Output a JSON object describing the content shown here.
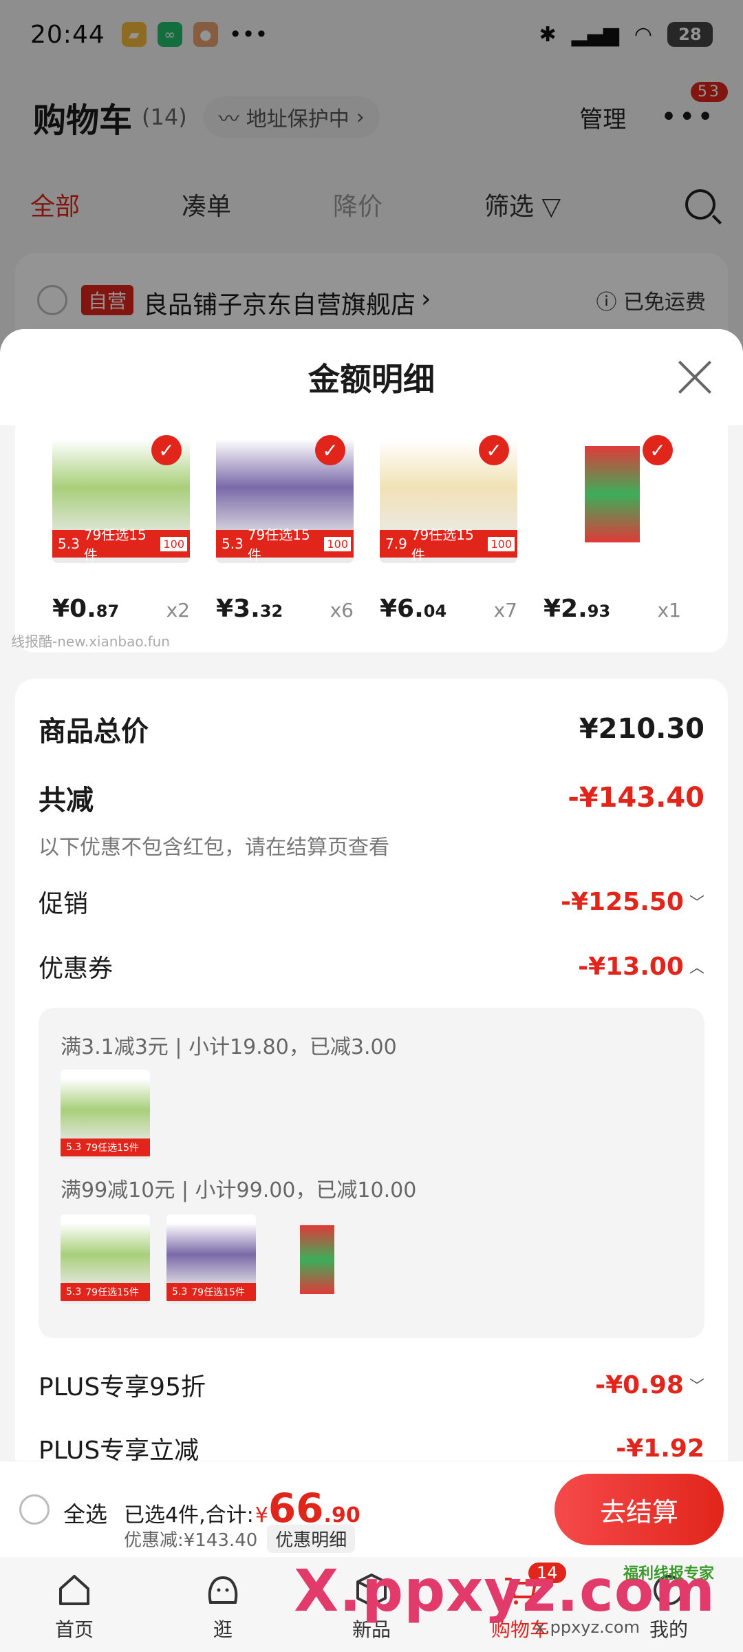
{
  "status_bar": {
    "time": "20:44",
    "dots": "•••",
    "battery": "28"
  },
  "cart": {
    "title": "购物车",
    "count": "(14)",
    "address_pill": "地址保护中",
    "manage": "管理",
    "more_badge": "53",
    "tabs": [
      "全部",
      "凑单",
      "降价",
      "筛选"
    ],
    "shop": {
      "self_tag": "自营",
      "name": "良品铺子京东自营旗舰店",
      "shipping": "已免运费"
    }
  },
  "sheet": {
    "title": "金额明细",
    "watermark": "线报酷-new.xianbao.fun",
    "products": [
      {
        "price_int": "¥0.",
        "price_dec": "87",
        "qty": "x2",
        "color": "#a8cf7a",
        "promo": "79任选15件",
        "promo_price": "5.3"
      },
      {
        "price_int": "¥3.",
        "price_dec": "32",
        "qty": "x6",
        "color": "#7a6aa8",
        "promo": "79任选15件",
        "promo_price": "5.3"
      },
      {
        "price_int": "¥6.",
        "price_dec": "04",
        "qty": "x7",
        "color": "#f1e2b6",
        "promo": "79任选15件",
        "promo_price": "7.9"
      },
      {
        "price_int": "¥2.",
        "price_dec": "93",
        "qty": "x1",
        "color": "#e03a3a",
        "promo": "",
        "promo_price": ""
      }
    ],
    "total_label": "商品总价",
    "total_value": "¥210.30",
    "reduce_label": "共减",
    "reduce_value": "-¥143.40",
    "reduce_note": "以下优惠不包含红包，请在结算页查看",
    "promo_label": "促销",
    "promo_value": "-¥125.50",
    "coupon_label": "优惠券",
    "coupon_value": "-¥13.00",
    "coupon_lines": [
      "满3.1减3元 | 小计19.80，已减3.00",
      "满99减10元 | 小计99.00，已减10.00"
    ],
    "plus_discount_label": "PLUS专享95折",
    "plus_discount_value": "-¥0.98",
    "plus_reduce_label": "PLUS专享立减",
    "plus_reduce_value": "-¥1.92"
  },
  "bottom_bar": {
    "select_all": "全选",
    "selected_text": "已选4件,合计:",
    "yen": "¥",
    "total_int": "66",
    "total_dec": ".90",
    "discount_text": "优惠减:¥143.40",
    "detail_button": "优惠明细",
    "checkout": "去结算"
  },
  "tab_bar": {
    "items": [
      "首页",
      "逛",
      "新品",
      "购物车",
      "我的"
    ],
    "cart_badge": "14"
  },
  "overlay_watermark": {
    "big": "X.ppxyz.com",
    "small": "x.ppxyz.com",
    "brand": "福利线报专家"
  },
  "colors": {
    "accent": "#e1251b",
    "background": "#f4f4f4"
  }
}
